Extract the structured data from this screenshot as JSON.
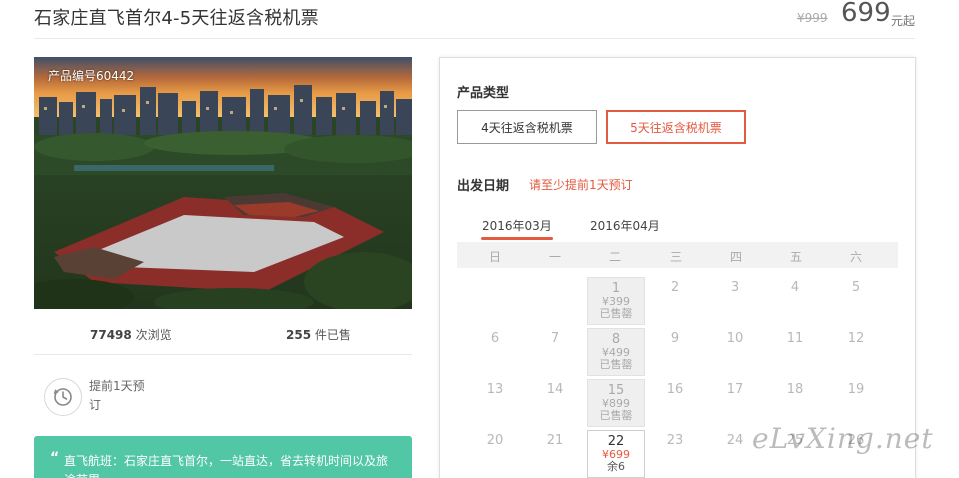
{
  "header": {
    "title": "石家庄直飞首尔4-5天往返含税机票",
    "price_original": "¥999",
    "price_current": "699",
    "price_unit": "元起"
  },
  "product": {
    "number_label": "产品编号60442",
    "views_count": "77498",
    "views_label": " 次浏览",
    "sold_count": "255",
    "sold_label": " 件已售",
    "advance_note": "提前1天预订",
    "highlight_quote": "“",
    "highlight_text": "直飞航班：石家庄直飞首尔，一站直达，省去转机时间以及旅途劳累"
  },
  "booking": {
    "type_label": "产品类型",
    "type_options": [
      "4天往返含税机票",
      "5天往返含税机票"
    ],
    "selected_type": "5天往返含税机票",
    "date_label": "出发日期",
    "date_tip": "请至少提前1天预订",
    "months": [
      "2016年03月",
      "2016年04月"
    ],
    "selected_month": "2016年03月",
    "weekdays": [
      "日",
      "一",
      "二",
      "三",
      "四",
      "五",
      "六"
    ]
  },
  "calendar": {
    "weeks": [
      [
        "",
        "",
        "1",
        "2",
        "3",
        "4",
        "5"
      ],
      [
        "6",
        "7",
        "8",
        "9",
        "10",
        "11",
        "12"
      ],
      [
        "13",
        "14",
        "15",
        "16",
        "17",
        "18",
        "19"
      ],
      [
        "20",
        "21",
        "22",
        "23",
        "24",
        "25",
        "26"
      ]
    ],
    "priced_days": [
      {
        "day": "1",
        "price": "¥399",
        "status": "已售罄"
      },
      {
        "day": "8",
        "price": "¥499",
        "status": "已售罄"
      },
      {
        "day": "15",
        "price": "¥899",
        "status": "已售罄"
      },
      {
        "day": "22",
        "price": "¥699",
        "status": "余6"
      }
    ]
  },
  "watermark": "eLvXing.net",
  "colors": {
    "accent": "#e4593f",
    "green": "#52c7a6"
  }
}
